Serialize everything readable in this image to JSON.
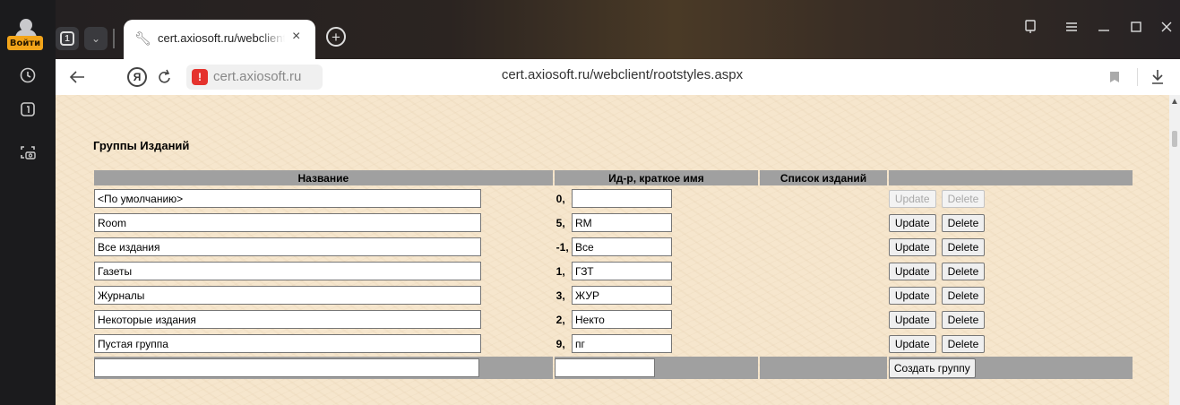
{
  "browser": {
    "signin_label": "Войти",
    "tab_count": "1",
    "tab_title": "cert.axiosoft.ru/webclient",
    "site_domain": "cert.axiosoft.ru",
    "url": "cert.axiosoft.ru/webclient/rootstyles.aspx",
    "tab_close": "×",
    "new_tab": "+",
    "left_icons": [
      "history-icon",
      "tabs-icon",
      "screenshot-icon"
    ],
    "window_controls": [
      "pin-tab-icon",
      "menu-icon",
      "minimize-icon",
      "maximize-icon",
      "close-icon"
    ]
  },
  "page": {
    "heading": "Группы Изданий",
    "columns": [
      "Название",
      "Ид-р, краткое имя",
      "Список изданий",
      ""
    ],
    "rows": [
      {
        "name": "<По умолчанию>",
        "id": "0,",
        "short": "",
        "update": "Update",
        "delete": "Delete",
        "disabled": true
      },
      {
        "name": "Room",
        "id": "5,",
        "short": "RM",
        "update": "Update",
        "delete": "Delete",
        "disabled": false
      },
      {
        "name": "Все издания",
        "id": "-1,",
        "short": "Все",
        "update": "Update",
        "delete": "Delete",
        "disabled": false
      },
      {
        "name": "Газеты",
        "id": "1,",
        "short": "ГЗТ",
        "update": "Update",
        "delete": "Delete",
        "disabled": false
      },
      {
        "name": "Журналы",
        "id": "3,",
        "short": "ЖУР",
        "update": "Update",
        "delete": "Delete",
        "disabled": false
      },
      {
        "name": "Некоторые издания",
        "id": "2,",
        "short": "Некто",
        "update": "Update",
        "delete": "Delete",
        "disabled": false
      },
      {
        "name": "Пустая группа",
        "id": "9,",
        "short": "пг",
        "update": "Update",
        "delete": "Delete",
        "disabled": false
      }
    ],
    "new_row": {
      "name": "",
      "short": "",
      "create_label": "Создать группу"
    }
  }
}
